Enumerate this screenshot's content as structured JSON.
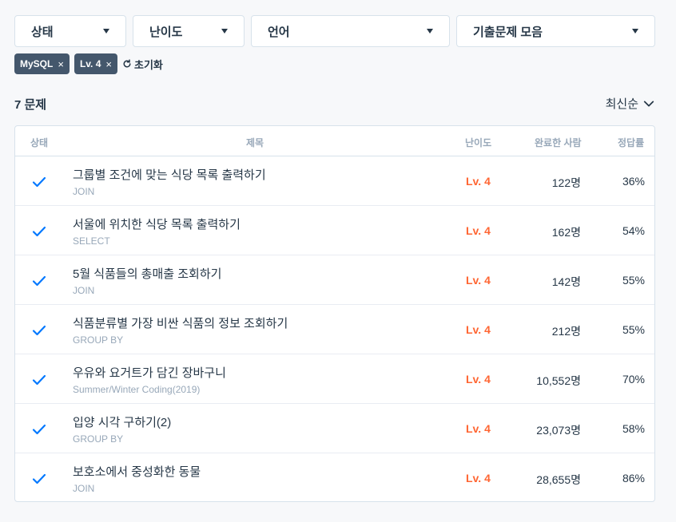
{
  "filters": [
    {
      "label": "상태"
    },
    {
      "label": "난이도"
    },
    {
      "label": "언어"
    },
    {
      "label": "기출문제 모음"
    }
  ],
  "chips": [
    {
      "label": "MySQL",
      "remove": "×"
    },
    {
      "label": "Lv. 4",
      "remove": "×"
    }
  ],
  "reset_label": "초기화",
  "count_label": "7 문제",
  "sort_label": "최신순",
  "table": {
    "headers": {
      "status": "상태",
      "title": "제목",
      "level": "난이도",
      "solved": "완료한 사람",
      "rate": "정답률"
    },
    "rows": [
      {
        "title": "그룹별 조건에 맞는 식당 목록 출력하기",
        "category": "JOIN",
        "level": "Lv. 4",
        "solved": "122명",
        "rate": "36%"
      },
      {
        "title": "서울에 위치한 식당 목록 출력하기",
        "category": "SELECT",
        "level": "Lv. 4",
        "solved": "162명",
        "rate": "54%"
      },
      {
        "title": "5월 식품들의 총매출 조회하기",
        "category": "JOIN",
        "level": "Lv. 4",
        "solved": "142명",
        "rate": "55%"
      },
      {
        "title": "식품분류별 가장 비싼 식품의 정보 조회하기",
        "category": "GROUP BY",
        "level": "Lv. 4",
        "solved": "212명",
        "rate": "55%"
      },
      {
        "title": "우유와 요거트가 담긴 장바구니",
        "category": "Summer/Winter Coding(2019)",
        "level": "Lv. 4",
        "solved": "10,552명",
        "rate": "70%"
      },
      {
        "title": "입양 시각 구하기(2)",
        "category": "GROUP BY",
        "level": "Lv. 4",
        "solved": "23,073명",
        "rate": "58%"
      },
      {
        "title": "보호소에서 중성화한 동물",
        "category": "JOIN",
        "level": "Lv. 4",
        "solved": "28,655명",
        "rate": "86%"
      }
    ]
  },
  "colors": {
    "level": "#ff6633",
    "check": "#0078ff",
    "chip_bg": "#44576c"
  },
  "icons": {
    "status": "check-icon",
    "reset": "refresh-icon",
    "sort": "chevron-down-icon",
    "dropdown": "caret-down-icon"
  }
}
